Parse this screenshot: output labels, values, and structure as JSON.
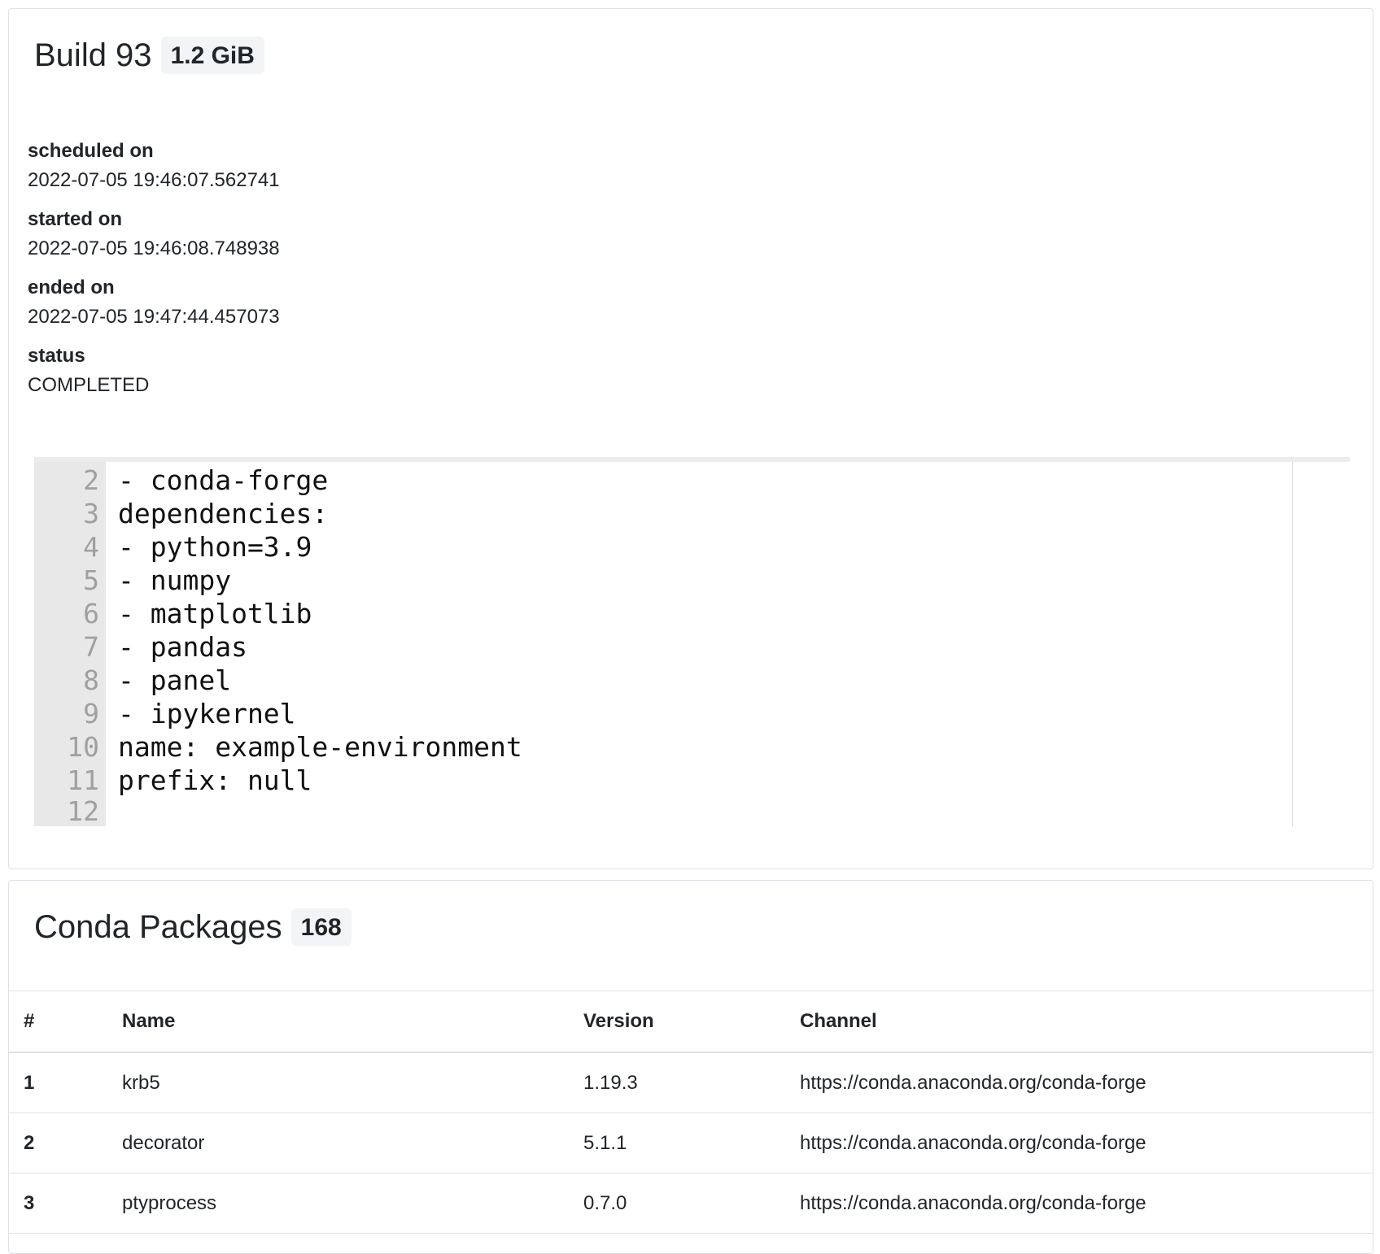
{
  "build": {
    "title": "Build 93",
    "size": "1.2 GiB",
    "fields": [
      {
        "label": "scheduled on",
        "value": "2022-07-05 19:46:07.562741"
      },
      {
        "label": "started on",
        "value": "2022-07-05 19:46:08.748938"
      },
      {
        "label": "ended on",
        "value": "2022-07-05 19:47:44.457073"
      },
      {
        "label": "status",
        "value": "COMPLETED"
      }
    ],
    "spec_lines": [
      {
        "n": "2",
        "text": "- conda-forge"
      },
      {
        "n": "3",
        "text": "dependencies:"
      },
      {
        "n": "4",
        "text": "- python=3.9"
      },
      {
        "n": "5",
        "text": "- numpy"
      },
      {
        "n": "6",
        "text": "- matplotlib"
      },
      {
        "n": "7",
        "text": "- pandas"
      },
      {
        "n": "8",
        "text": "- panel"
      },
      {
        "n": "9",
        "text": "- ipykernel"
      },
      {
        "n": "10",
        "text": "name: example-environment"
      },
      {
        "n": "11",
        "text": "prefix: null"
      },
      {
        "n": "12",
        "text": ""
      }
    ]
  },
  "packages": {
    "title": "Conda Packages",
    "count": "168",
    "columns": [
      "#",
      "Name",
      "Version",
      "Channel"
    ],
    "rows": [
      {
        "num": "1",
        "name": "krb5",
        "version": "1.19.3",
        "channel": "https://conda.anaconda.org/conda-forge"
      },
      {
        "num": "2",
        "name": "decorator",
        "version": "5.1.1",
        "channel": "https://conda.anaconda.org/conda-forge"
      },
      {
        "num": "3",
        "name": "ptyprocess",
        "version": "0.7.0",
        "channel": "https://conda.anaconda.org/conda-forge"
      }
    ]
  }
}
